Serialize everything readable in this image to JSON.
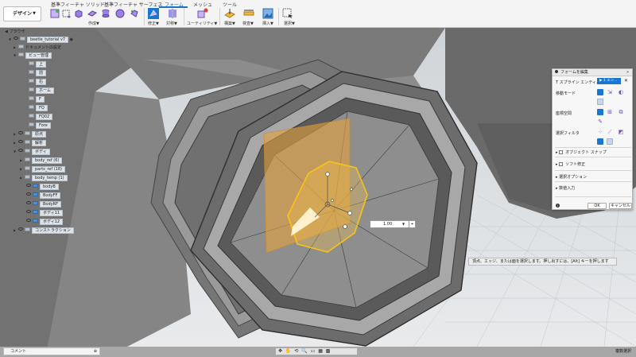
{
  "toolbar": {
    "workspace": "デザイン",
    "tabs": [
      "基準フィーチャ ソリッド",
      "基準フィーチャ サーフェス",
      "フォーム",
      "メッシュ",
      "ツール"
    ],
    "active_tab": "フォーム",
    "groups": [
      "作成▼",
      "修正▼",
      "対称▼",
      "ユーティリティ▼",
      "構築▼",
      "検査▼",
      "挿入▼",
      "選択▼"
    ],
    "accent": "#1a76c9"
  },
  "browser": {
    "title": "ブラウザ",
    "items": [
      {
        "label": "beetle_tutorial v7"
      },
      {
        "label": "ドキュメントの設定"
      },
      {
        "label": "ビュー管理"
      },
      {
        "label": "上"
      },
      {
        "label": "前"
      },
      {
        "label": "右"
      },
      {
        "label": "ホーム"
      },
      {
        "label": "F"
      },
      {
        "label": "FQ"
      },
      {
        "label": "FQ02"
      },
      {
        "label": "Fore"
      },
      {
        "label": "原点"
      },
      {
        "label": "解析"
      },
      {
        "label": "ボディ"
      },
      {
        "label": "body_ref (6)"
      },
      {
        "label": "parts_ref (18)"
      },
      {
        "label": "body_temp (1)"
      },
      {
        "label": "bodyB"
      },
      {
        "label": "BodyFF"
      },
      {
        "label": "BodyRF"
      },
      {
        "label": "ボディ11"
      },
      {
        "label": "ボディ12"
      },
      {
        "label": "コンストラクション"
      }
    ]
  },
  "dialog": {
    "title": "フォームを編集",
    "tspline_label": "T スプライン エンティ...",
    "selected_chip": "▶ 1 エン...",
    "transform_mode": "移動モード",
    "coord_space": "座標空間",
    "selection_filter": "選択フィルタ",
    "object_snap": "オブジェクト スナップ",
    "soft_modify": "ソフト修正",
    "selection_options": "選択オプション",
    "numeric_input": "数値入力",
    "ok": "OK",
    "cancel": "キャンセル"
  },
  "viewport": {
    "value_input": "1.00",
    "hint": "頂点、エッジ、または面を選択します。押し出すには、[Alt] キーを押します"
  },
  "bottom": {
    "comments": "コメント",
    "nav_icons": "✥ ✋ ⟲ 🔍 ▭ ▦ ▩",
    "multi_select": "複数選択"
  }
}
